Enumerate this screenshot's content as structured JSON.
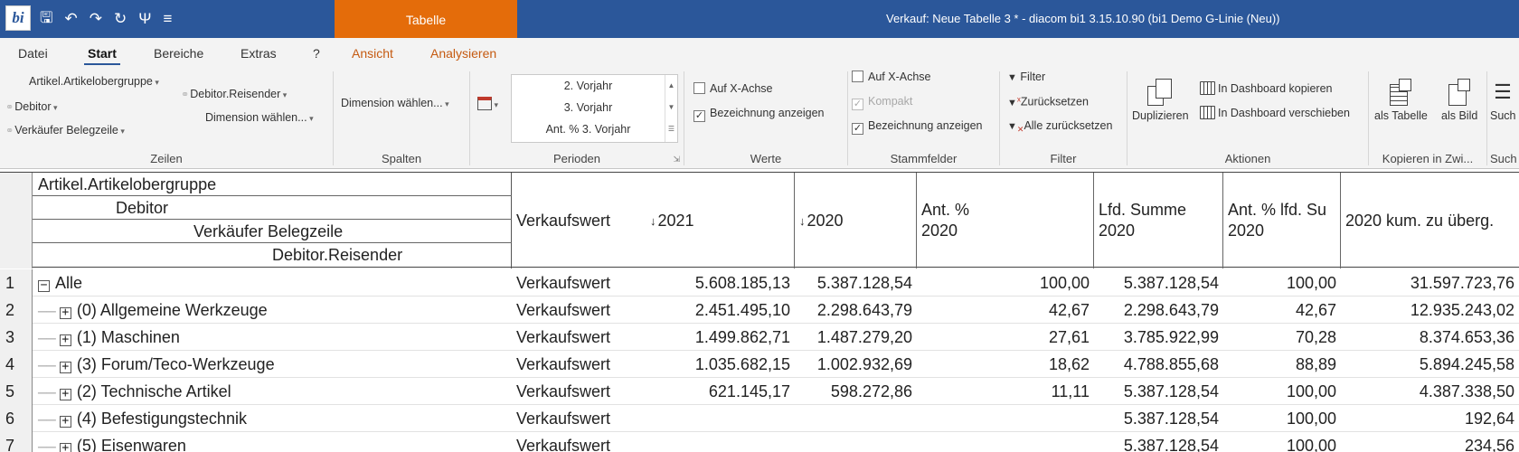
{
  "title_bar": {
    "context_tab": "Tabelle",
    "window_title": "Verkauf: Neue Tabelle 3 * - diacom bi1 3.15.10.90 (bi1 Demo G-Linie (Neu))",
    "logo_text": "bi"
  },
  "quick_access": [
    {
      "name": "save-icon",
      "glyph": "🖫"
    },
    {
      "name": "undo-icon",
      "glyph": "↶"
    },
    {
      "name": "redo-icon",
      "glyph": "↷"
    },
    {
      "name": "refresh-icon",
      "glyph": "↻"
    },
    {
      "name": "tools-icon",
      "glyph": "Ψ"
    },
    {
      "name": "customize-qat-icon",
      "glyph": "≡"
    }
  ],
  "ribbon_tabs": [
    {
      "label": "Datei",
      "left": 0
    },
    {
      "label": "Start",
      "active": true
    },
    {
      "label": "Bereiche"
    },
    {
      "label": "Extras"
    },
    {
      "label": "?"
    },
    {
      "label": "Ansicht",
      "context": true
    },
    {
      "label": "Analysieren",
      "context": true
    }
  ],
  "ribbon": {
    "zeilen": {
      "label": "Zeilen",
      "items": [
        "Artikel.Artikelobergruppe",
        "Debitor",
        "Verkäufer Belegzeile",
        "Debitor.Reisender",
        "Dimension wählen..."
      ]
    },
    "spalten": {
      "label": "Spalten",
      "item": "Dimension wählen..."
    },
    "perioden": {
      "label": "Perioden",
      "items": [
        "2. Vorjahr",
        "3. Vorjahr",
        "Ant. % 3. Vorjahr"
      ]
    },
    "werte": {
      "label": "Werte",
      "items": [
        {
          "label": "Auf X-Achse",
          "checked": false
        },
        {
          "label": "Bezeichnung anzeigen",
          "checked": true
        }
      ]
    },
    "stammfelder": {
      "label": "Stammfelder",
      "items": [
        {
          "label": "Auf X-Achse",
          "checked": false
        },
        {
          "label": "Kompakt",
          "checked": true,
          "disabled": true
        },
        {
          "label": "Bezeichnung anzeigen",
          "checked": true
        }
      ]
    },
    "filter": {
      "label": "Filter",
      "items": [
        "Filter",
        "Zurücksetzen",
        "Alle zurücksetzen"
      ]
    },
    "aktionen": {
      "label": "Aktionen",
      "duplicate": "Duplizieren",
      "copy": "In Dashboard kopieren",
      "move": "In Dashboard verschieben"
    },
    "kopieren": {
      "label": "Kopieren in Zwi...",
      "as_table": "als Tabelle",
      "as_image": "als Bild"
    },
    "suche": {
      "label": "Such",
      "button": "Such"
    }
  },
  "grid": {
    "row_dims": [
      "Artikel.Artikelobergruppe",
      "Debitor",
      "Verkäufer Belegzeile",
      "Debitor.Reisender"
    ],
    "columns": [
      {
        "label": "Verkaufswert"
      },
      {
        "label": "2021",
        "sort": "↓"
      },
      {
        "label": "2020",
        "sort": "↓"
      },
      {
        "label": "Ant. %\n2020"
      },
      {
        "label": "Lfd. Summe\n2020"
      },
      {
        "label": "Ant. % lfd. Su\n2020"
      },
      {
        "label": "2020 kum. zu überg."
      }
    ],
    "rows": [
      {
        "n": "1",
        "label": "Alle",
        "root": true,
        "measure": "Verkaufswert",
        "v2021": "5.608.185,13",
        "v2020": "5.387.128,54",
        "ant": "100,00",
        "lfd": "5.387.128,54",
        "antlfd": "100,00",
        "kum": "31.597.723,76"
      },
      {
        "n": "2",
        "label": "(0) Allgemeine Werkzeuge",
        "measure": "Verkaufswert",
        "v2021": "2.451.495,10",
        "v2020": "2.298.643,79",
        "ant": "42,67",
        "lfd": "2.298.643,79",
        "antlfd": "42,67",
        "kum": "12.935.243,02"
      },
      {
        "n": "3",
        "label": "(1) Maschinen",
        "measure": "Verkaufswert",
        "v2021": "1.499.862,71",
        "v2020": "1.487.279,20",
        "ant": "27,61",
        "lfd": "3.785.922,99",
        "antlfd": "70,28",
        "kum": "8.374.653,36"
      },
      {
        "n": "4",
        "label": "(3) Forum/Teco-Werkzeuge",
        "measure": "Verkaufswert",
        "v2021": "1.035.682,15",
        "v2020": "1.002.932,69",
        "ant": "18,62",
        "lfd": "4.788.855,68",
        "antlfd": "88,89",
        "kum": "5.894.245,58"
      },
      {
        "n": "5",
        "label": "(2) Technische Artikel",
        "measure": "Verkaufswert",
        "v2021": "621.145,17",
        "v2020": "598.272,86",
        "ant": "11,11",
        "lfd": "5.387.128,54",
        "antlfd": "100,00",
        "kum": "4.387.338,50"
      },
      {
        "n": "6",
        "label": "(4) Befestigungstechnik",
        "measure": "Verkaufswert",
        "v2021": "",
        "v2020": "",
        "ant": "",
        "lfd": "5.387.128,54",
        "antlfd": "100,00",
        "kum": "192,64"
      },
      {
        "n": "7",
        "label": "(5) Eisenwaren",
        "measure": "Verkaufswert",
        "v2021": "",
        "v2020": "",
        "ant": "",
        "lfd": "5.387.128,54",
        "antlfd": "100,00",
        "kum": "234,56"
      }
    ]
  }
}
